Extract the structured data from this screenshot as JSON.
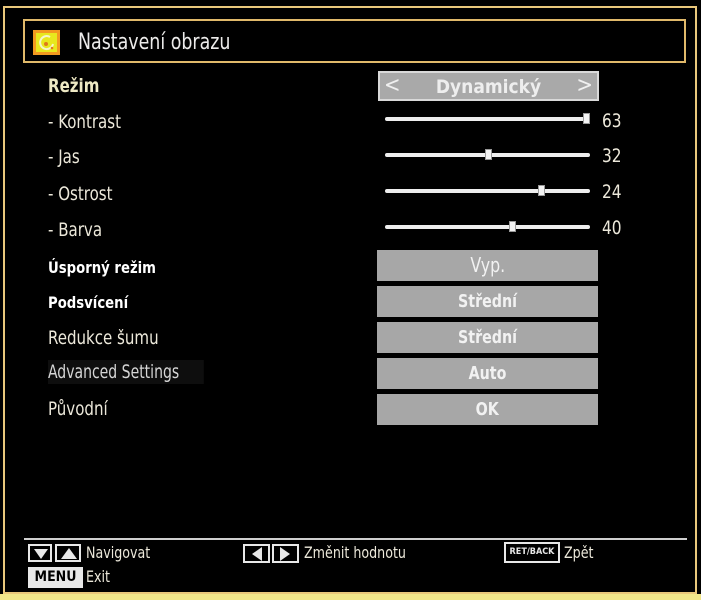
{
  "window": {
    "title": "Nastavení obrazu",
    "title_icon": "picture-settings-icon"
  },
  "mode": {
    "label": "Režim",
    "value": "Dynamický",
    "prev_icon": "chevron-left-icon",
    "next_icon": "chevron-right-icon"
  },
  "sliders": [
    {
      "label": "- Kontrast",
      "value": "63",
      "fill_fraction": 0.98
    },
    {
      "label": "- Jas",
      "value": "32",
      "fill_fraction": 0.5
    },
    {
      "label": "- Ostrost",
      "value": "24",
      "fill_fraction": 0.76
    },
    {
      "label": "- Barva",
      "value": "40",
      "fill_fraction": 0.62
    }
  ],
  "options": [
    {
      "label": "Úsporný režim",
      "value": "Vyp."
    },
    {
      "label": "Podsvícení",
      "value": "Střední"
    },
    {
      "label": "Redukce šumu",
      "value": "Střední"
    },
    {
      "label": "Advanced Settings",
      "value": "Auto"
    },
    {
      "label": "Původní",
      "value": "OK"
    }
  ],
  "footer": {
    "navigate": {
      "keys": [
        "down-arrow-key",
        "up-arrow-key"
      ],
      "label": "Navigovat"
    },
    "change": {
      "keys": [
        "left-arrow-key",
        "right-arrow-key"
      ],
      "label": "Změnit hodnotu"
    },
    "back": {
      "key": "RET/BACK",
      "label": "Zpět"
    },
    "exit": {
      "key": "MENU",
      "label": "Exit"
    }
  },
  "colors": {
    "frame": "#e9c77b",
    "button_bg": "#a7a7a7",
    "title_icon_bg": "#e8e81e"
  }
}
